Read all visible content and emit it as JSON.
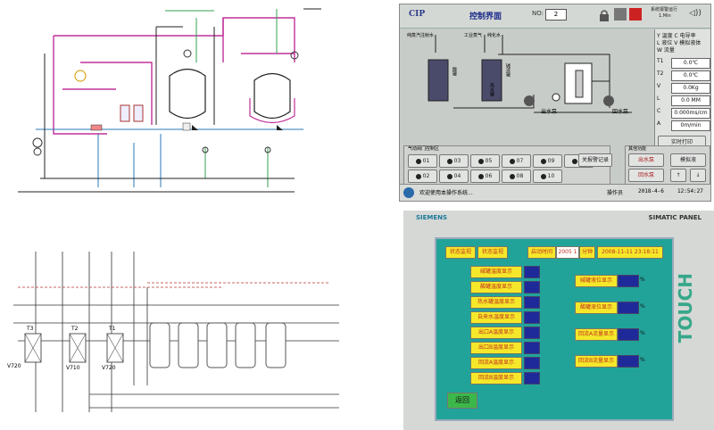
{
  "cip": {
    "app_name": "CIP",
    "screen_title": "控制界面",
    "no_label": "NO:",
    "no_value": "2",
    "top_right_text_1": "系统报警运行",
    "top_right_text_2": "1.Min",
    "legend": [
      "Y 温度",
      "C 电导率",
      "L 液位",
      "V 模拟液体",
      "W 流量"
    ],
    "params": [
      {
        "key": "T1",
        "value": "0.0℃"
      },
      {
        "key": "T2",
        "value": "0.0℃"
      },
      {
        "key": "V",
        "value": "0.0Kg"
      },
      {
        "key": "L",
        "value": "0.0 MM"
      },
      {
        "key": "C",
        "value": "0.000ms/cm"
      },
      {
        "key": "A",
        "value": "0m/min"
      }
    ],
    "tank_labels": {
      "acid": "酸罐",
      "caustic": "碱液罐",
      "hot_water": "热水罐"
    },
    "feed_labels": [
      "纯蒸汽注射水",
      "工业蒸气",
      "纯化水"
    ],
    "pump_labels": {
      "supply": "出水泵",
      "return": "回水泵"
    },
    "valve_section_title": "气动阀门控制区",
    "valves": [
      "01",
      "03",
      "05",
      "07",
      "09",
      "11",
      "02",
      "04",
      "06",
      "08",
      "10"
    ],
    "alarm_button": "关报警记录",
    "side_control_title": "其他功能",
    "side_buttons": [
      "出水泵",
      "回水泵",
      "模拟液",
      "↑",
      "↓"
    ],
    "print_button": "实时打印",
    "status_message": "欢迎使用本操作系统...",
    "operator_label": "操作员",
    "date": "2018-4-6",
    "time": "12:54:27"
  },
  "siemens": {
    "brand": "SIEMENS",
    "panel_label": "SIMATIC PANEL",
    "touch_label": "TOUCH",
    "header_items": [
      "状态监视",
      "状态监视",
      "启动时间",
      "2005 1",
      "分钟",
      "2008-11-11 23:18:11"
    ],
    "left_rows": [
      "碱罐温度显示",
      "酸罐温度显示",
      "热水罐温度显示",
      "自来水温度显示",
      "出口A温度显示",
      "出口B温度显示",
      "回流A温度显示",
      "回流B温度显示"
    ],
    "right_rows": [
      "碱罐液位显示",
      "酸罐液位显示",
      "回流A流量显示",
      "回流B流量显示"
    ],
    "unit": "℃",
    "right_unit": "%",
    "bottom_button": "返回"
  },
  "drawing": {
    "labels_bl": [
      "T3",
      "T2",
      "T1",
      "V720",
      "V710",
      "V720"
    ]
  }
}
